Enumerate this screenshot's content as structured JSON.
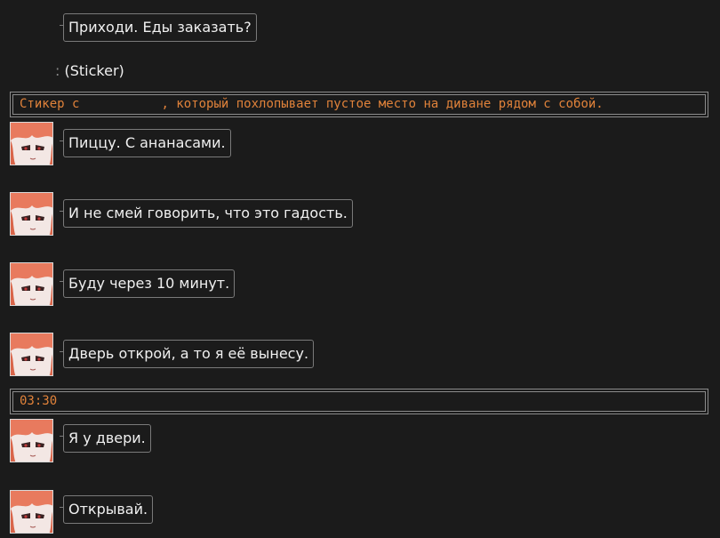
{
  "messages": [
    {
      "text": "Приходи. Еды заказать?"
    },
    {
      "text": "Пиццу. С ананасами."
    },
    {
      "text": "И не смей говорить, что это гадость."
    },
    {
      "text": "Буду через 10 минут."
    },
    {
      "text": "Дверь открой, а то я её вынесу."
    },
    {
      "text": "Я у двери."
    },
    {
      "text": "Открывай."
    }
  ],
  "sticker": {
    "label": "(Sticker)",
    "description_before": "Стикер с",
    "description_after": ", который похлопывает пустое место на диване рядом с собой."
  },
  "timestamp": "03:30",
  "colors": {
    "background": "#1b1b1b",
    "bubble_border": "#7a7a7a",
    "note_text": "#e0823a",
    "avatar_hair": "#e87a5e"
  },
  "icons": {
    "avatar": "avatar-icon"
  }
}
